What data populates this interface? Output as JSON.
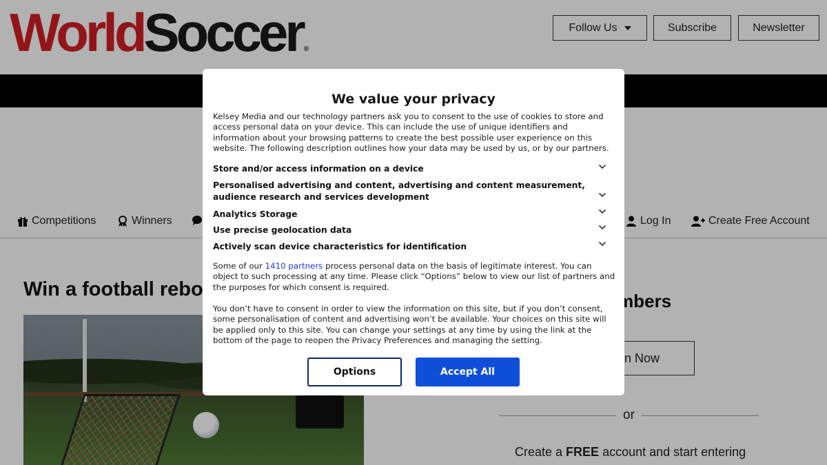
{
  "header": {
    "logo_part1": "World",
    "logo_part2": "Soccer",
    "logo_registered": "®",
    "follow_label": "Follow Us",
    "subscribe_label": "Subscribe",
    "newsletter_label": "Newsletter"
  },
  "nav": {
    "competitions": "Competitions",
    "winners": "Winners",
    "login": "Log In",
    "create_account": "Create Free Account"
  },
  "article": {
    "title_visible": "Win a football rebou"
  },
  "sidebar": {
    "heading_visible": "Members",
    "join_visible": "n Now",
    "or": "or",
    "free_pre": "Create a ",
    "free_bold": "FREE",
    "free_post": " account and start entering"
  },
  "consent": {
    "title": "We value your privacy",
    "intro": "Kelsey Media and our technology partners ask you to consent to the use of cookies to store and access personal data on your device. This can include the use of unique identifiers and information about your browsing patterns to create the best possible user experience on this website. The following description outlines how your data may be used by us, or by our partners.",
    "purposes": [
      "Store and/or access information on a device",
      "Personalised advertising and content, advertising and content measurement, audience research and services development",
      "Analytics Storage",
      "Use precise geolocation data",
      "Actively scan device characteristics for identification"
    ],
    "legit_pre": "Some of our ",
    "partners_link": "1410 partners",
    "legit_post": " process personal data on the basis of legitimate interest. You can object to such processing at any time. Please click “Options” below to view our list of partners and the purposes for which consent is required.",
    "no_consent": "You don’t have to consent in order to view the information on this site, but if you don’t consent, some personalisation of content and advertising won’t be available. Your choices on this site will be applied only to this site. You can change your settings at any time by using the link at the bottom of the page to reopen the Privacy Preferences and managing the setting.",
    "options_label": "Options",
    "accept_label": "Accept All"
  },
  "colors": {
    "accept_button": "#0e4fd8",
    "options_border": "#0b2a6b",
    "link": "#1a3bdb",
    "logo_red": "#d11f26"
  }
}
